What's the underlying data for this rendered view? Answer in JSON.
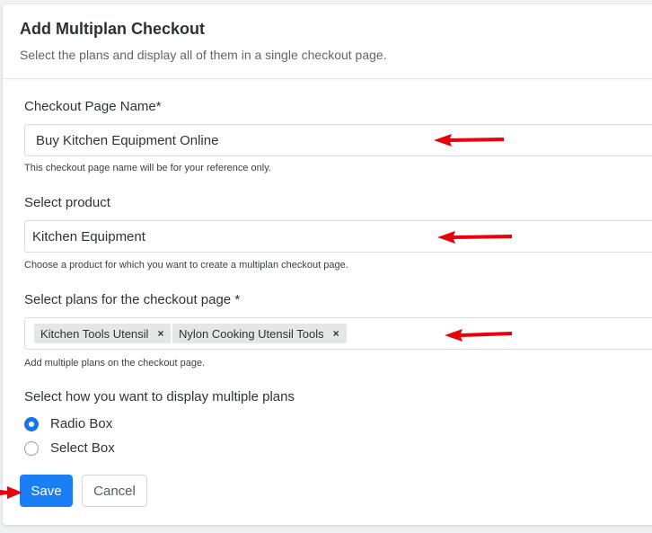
{
  "header": {
    "title": "Add Multiplan Checkout",
    "subtitle": "Select the plans and display all of them in a single checkout page."
  },
  "checkout_name": {
    "label": "Checkout Page Name*",
    "value": "Buy Kitchen Equipment Online",
    "help": "This checkout page name will be for your reference only."
  },
  "product": {
    "label": "Select product",
    "value": "Kitchen Equipment",
    "help": "Choose a product for which you want to create a multiplan checkout page."
  },
  "plans": {
    "label": "Select plans for the checkout page *",
    "chips": [
      "Kitchen Tools Utensil",
      "Nylon Cooking Utensil Tools"
    ],
    "remove_symbol": "×",
    "help": "Add multiple plans on the checkout page."
  },
  "display": {
    "label": "Select how you want to display multiple plans",
    "options": [
      {
        "label": "Radio Box",
        "selected": true
      },
      {
        "label": "Select Box",
        "selected": false
      }
    ]
  },
  "actions": {
    "save": "Save",
    "cancel": "Cancel"
  },
  "colors": {
    "primary": "#1a7ff5",
    "annotation_arrow": "#e8000b"
  }
}
